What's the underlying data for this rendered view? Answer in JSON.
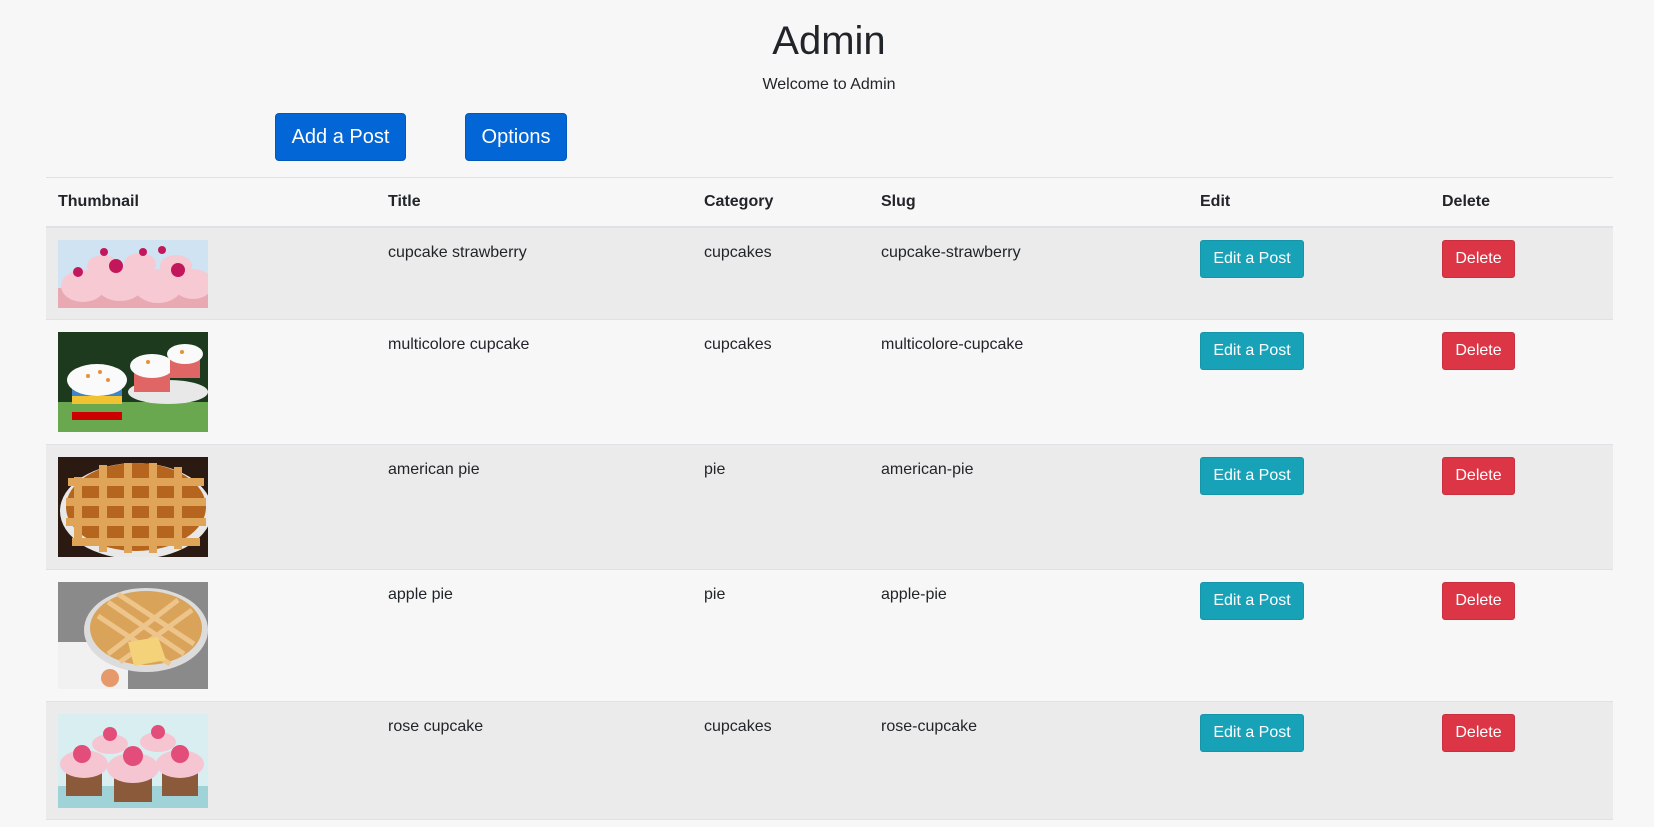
{
  "header": {
    "title": "Admin",
    "welcome": "Welcome to Admin"
  },
  "actions": {
    "add_label": "Add a Post",
    "options_label": "Options"
  },
  "table": {
    "columns": [
      "Thumbnail",
      "Title",
      "Category",
      "Slug",
      "Edit",
      "Delete"
    ],
    "rows": [
      {
        "title": "cupcake strawberry",
        "category": "cupcakes",
        "slug": "cupcake-strawberry",
        "edit_label": "Edit a Post",
        "delete_label": "Delete",
        "thumbnail": "strawberry-cupcakes-image"
      },
      {
        "title": "multicolore cupcake",
        "category": "cupcakes",
        "slug": "multicolore-cupcake",
        "edit_label": "Edit a Post",
        "delete_label": "Delete",
        "thumbnail": "rainbow-cupcakes-image"
      },
      {
        "title": "american pie",
        "category": "pie",
        "slug": "american-pie",
        "edit_label": "Edit a Post",
        "delete_label": "Delete",
        "thumbnail": "lattice-pie-image"
      },
      {
        "title": "apple pie",
        "category": "pie",
        "slug": "apple-pie",
        "edit_label": "Edit a Post",
        "delete_label": "Delete",
        "thumbnail": "apple-pie-image"
      },
      {
        "title": "rose cupcake",
        "category": "cupcakes",
        "slug": "rose-cupcake",
        "edit_label": "Edit a Post",
        "delete_label": "Delete",
        "thumbnail": "rose-cupcakes-image"
      }
    ]
  },
  "colors": {
    "primary": "#0366d6",
    "info": "#17a2b8",
    "danger": "#dc3545",
    "background": "#f7f7f7",
    "row_stripe": "#ebebeb"
  }
}
